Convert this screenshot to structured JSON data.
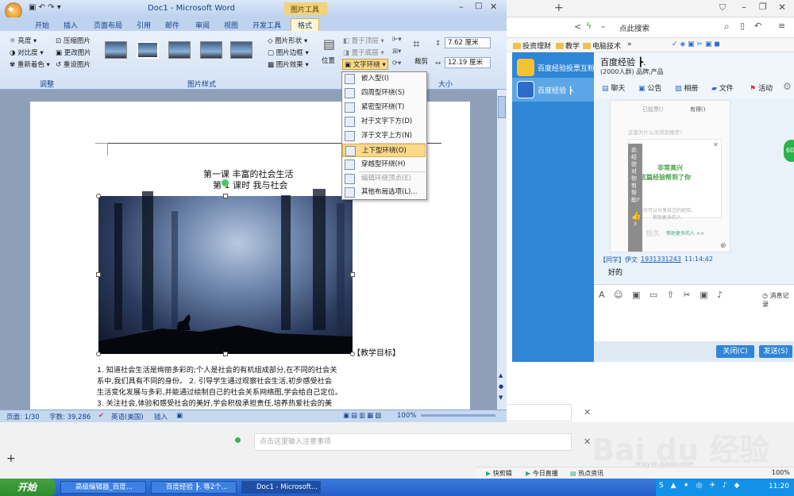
{
  "browser": {
    "search_placeholder": "点此搜索",
    "bookmarks": [
      "投资理财",
      "教学",
      "电脑技术"
    ],
    "more": "»",
    "lower": {
      "note_placeholder": "点击这里输入注意事项",
      "status_items": [
        "快剪辑",
        "今日直播",
        "热点资讯"
      ],
      "zoom": "100%"
    },
    "watermark": "Bai du 经验",
    "watermark_url": "jingyan.baidu.com"
  },
  "qq": {
    "list": [
      {
        "label": "百度经验投票互粉"
      },
      {
        "label": "百度经验 ┣."
      }
    ],
    "group_name": "百度经验 ┣.",
    "group_sub": "(2000人群) 品牌,产品",
    "toolbar": [
      "聊天",
      "公告",
      "相册",
      "文件",
      "活动"
    ],
    "msg_sender": "【同学】伊文",
    "msg_qq": "1931331243",
    "msg_time": "11:14:42",
    "msg_text": "好的",
    "ss_line1": "已投票()",
    "ss_line2": "有得()",
    "ss_question": "这篇为什么没得到推荐?",
    "ss_congrats1": "非常高兴",
    "ss_congrats2": "这篇经验帮到了你",
    "ss_share1": "您也可以分享自己的经验,",
    "ss_share2": "帮助更多的人",
    "ss_side": "此经验对你有帮助?",
    "ss_like": "3",
    "ss_link": "帮助更多的人 >>",
    "ss_similar": "相关",
    "msg_record": "消息记录",
    "close_btn": "关闭(C)",
    "send_btn": "发送(S)",
    "badge": "60"
  },
  "word": {
    "title": "Doc1 - Microsoft Word",
    "context_tab": "图片工具",
    "tabs": [
      "开始",
      "插入",
      "页面布局",
      "引用",
      "邮件",
      "审阅",
      "视图",
      "开发工具",
      "格式"
    ],
    "adjust": {
      "group": "调整",
      "items": [
        "亮度",
        "对比度",
        "重新着色",
        "压缩图片",
        "更改图片",
        "重设图片"
      ]
    },
    "styles": {
      "group": "图片样式",
      "items": [
        "图片形状",
        "图片边框",
        "图片效果"
      ]
    },
    "arrange": {
      "items": [
        "置于顶层",
        "置于底层",
        "文字环绕",
        "位置"
      ]
    },
    "size": {
      "group": "大小",
      "crop": "裁剪",
      "height": "7.62 厘米",
      "width": "12.19 厘米"
    },
    "doc": {
      "title1": "第一课  丰富的社会生活",
      "title2": "第 1 课时  我与社会",
      "goal": "【教学目标】",
      "para": [
        "1. 知道社会生活是绚丽多彩的;个人是社会的有机组成部分,在不同的社会关",
        "系中,我们具有不同的身份。   2. 引导学生通过观察社会生活,初步感受社会",
        "生活变化发展与多彩,并能通过绘制自己的社会关系网络图,学会给自己定位。",
        "3. 关注社会,体验和感受社会的美好,学会积极承担责任,培养热爱社会的美"
      ]
    },
    "status": {
      "page": "页面: 1/30",
      "words": "字数: 39,286",
      "lang": "英语(美国)",
      "mode": "插入",
      "zoom": "100%"
    }
  },
  "wrap_menu": {
    "items": [
      {
        "label": "嵌入型(I)",
        "state": "normal"
      },
      {
        "label": "四周型环绕(S)",
        "state": "normal"
      },
      {
        "label": "紧密型环绕(T)",
        "state": "normal"
      },
      {
        "label": "衬于文字下方(D)",
        "state": "normal"
      },
      {
        "label": "浮于文字上方(N)",
        "state": "normal"
      },
      {
        "label": "上下型环绕(O)",
        "state": "highlighted"
      },
      {
        "label": "穿越型环绕(H)",
        "state": "normal"
      },
      {
        "label": "编辑环绕顶点(E)",
        "state": "disabled"
      },
      {
        "label": "其他布局选项(L)...",
        "state": "normal"
      }
    ]
  },
  "taskbar": {
    "start": "开始",
    "items": [
      "高级编辑器_百度...",
      "百度经验 ┣. 等2个...",
      "Doc1 - Microsoft..."
    ],
    "clock": "11:20"
  }
}
